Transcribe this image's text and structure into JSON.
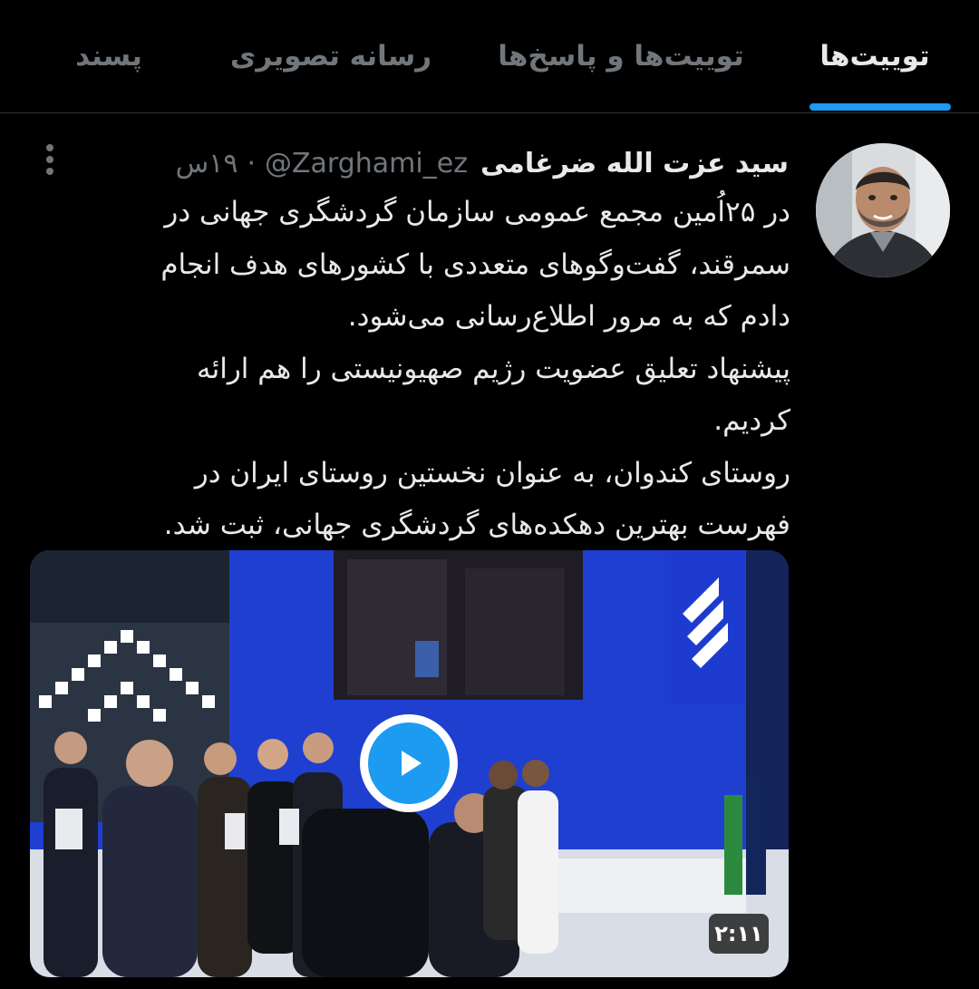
{
  "tabs": [
    {
      "label": "توییت‌ها",
      "active": true
    },
    {
      "label": "توییت‌ها و پاسخ‌ها",
      "active": false
    },
    {
      "label": "رسانه تصویری",
      "active": false
    },
    {
      "label": "پسند",
      "active": false
    }
  ],
  "tweet": {
    "author": {
      "display_name": "سید عزت الله ضرغامی",
      "handle": "@Zarghami_ez",
      "avatar_icon": "profile-photo"
    },
    "separator": "·",
    "time": "۱۹س",
    "more_icon": "more-vertical-icon",
    "text_lines": [
      "در ۲۵اُمین مجمع عمومی سازمان گردشگری جهانی در",
      "سمرقند، گفت‌وگوهای متعددی با کشورهای هدف انجام",
      "دادم که به مرور اطلاع‌رسانی می‌شود.",
      "پیشنهاد تعلیق عضویت رژیم صهیونیستی را هم ارائه",
      "کردیم.",
      "روستای کندوان، به عنوان نخستین روستای ایران در",
      "فهرست بهترین دهکده‌های گردشگری جهانی، ثبت شد."
    ],
    "media": {
      "type": "video",
      "duration": "۲:۱۱",
      "play_icon": "play-icon"
    }
  },
  "colors": {
    "background": "#000000",
    "text_primary": "#e7e9ea",
    "text_secondary": "#71767b",
    "accent": "#1d9bf0",
    "divider": "#2f3336"
  }
}
